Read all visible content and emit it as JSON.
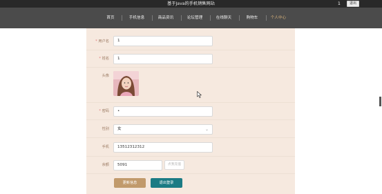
{
  "header": {
    "site_title": "基于Java的手机销售网站",
    "user_id": "1",
    "logout_label": "退出"
  },
  "nav": {
    "items": [
      {
        "label": "首页"
      },
      {
        "label": "手机信息"
      },
      {
        "label": "商品资讯"
      },
      {
        "label": "论坛管理"
      },
      {
        "label": "在线聊天"
      },
      {
        "label": "购物车"
      },
      {
        "label": "个人中心",
        "active": true
      }
    ],
    "active_color": "#d5b07a"
  },
  "form": {
    "username": {
      "label": "用户名",
      "required": "*",
      "value": "1"
    },
    "name": {
      "label": "姓名",
      "required": "*",
      "value": "1"
    },
    "avatar": {
      "label": "头像"
    },
    "password": {
      "label": "密码",
      "required": "*",
      "value": "•"
    },
    "gender": {
      "label": "性别",
      "value": "女"
    },
    "phone": {
      "label": "手机",
      "value": "13512312312"
    },
    "balance": {
      "label": "余额",
      "value": "5091",
      "recharge_label": "点我充值"
    }
  },
  "actions": {
    "update_label": "更新信息",
    "logout_label": "退出登录"
  },
  "colors": {
    "panel_bg": "#f6e9df",
    "update_btn": "#c19a6b",
    "logout_btn": "#1b7b84",
    "topbar": "#292929",
    "navbar": "#4b4b4b"
  }
}
